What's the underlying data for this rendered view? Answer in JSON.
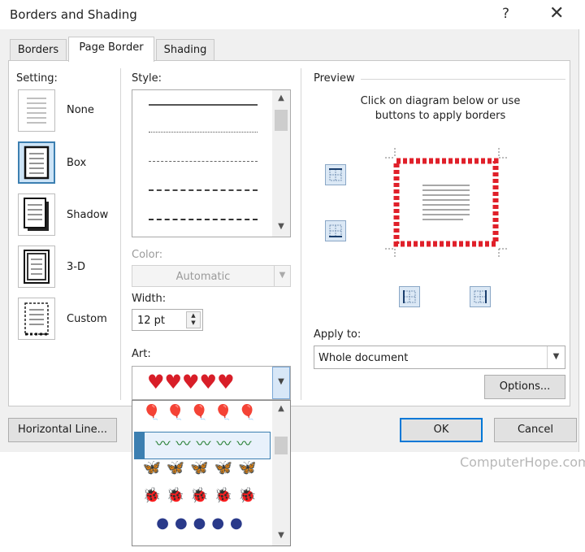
{
  "window": {
    "title": "Borders and Shading",
    "help": "?",
    "close": "✕"
  },
  "tabs": [
    {
      "label": "Borders",
      "active": false
    },
    {
      "label": "Page Border",
      "active": true
    },
    {
      "label": "Shading",
      "active": false
    }
  ],
  "setting": {
    "label": "Setting:",
    "options": [
      {
        "label": "None",
        "icon": "setting-none-icon",
        "selected": false
      },
      {
        "label": "Box",
        "icon": "setting-box-icon",
        "selected": true
      },
      {
        "label": "Shadow",
        "icon": "setting-shadow-icon",
        "selected": false
      },
      {
        "label": "3-D",
        "icon": "setting-3d-icon",
        "selected": false
      },
      {
        "label": "Custom",
        "icon": "setting-custom-icon",
        "selected": false
      }
    ]
  },
  "style": {
    "label": "Style:",
    "lines": [
      "solid",
      "dotted",
      "dashed-fine",
      "dashed",
      "dash-dot"
    ]
  },
  "color": {
    "label": "Color:",
    "value": "Automatic",
    "enabled": false
  },
  "width": {
    "label": "Width:",
    "value": "12 pt"
  },
  "art": {
    "label": "Art:",
    "selected": "red hearts",
    "options": [
      "red balloons",
      "green vines",
      "purple butterflies",
      "red ladybugs",
      "dark globes"
    ],
    "highlighted_index": 1,
    "highlight_color": "#3c7fb1"
  },
  "preview": {
    "label": "Preview",
    "instruction_line1": "Click on diagram below or use",
    "instruction_line2": "buttons to apply borders",
    "border_color": "#e0202a"
  },
  "apply_to": {
    "label": "Apply to:",
    "value": "Whole document"
  },
  "buttons": {
    "options": "Options...",
    "horizontal_line": "Horizontal Line...",
    "ok": "OK",
    "cancel": "Cancel"
  },
  "watermark": "ComputerHope.com",
  "colors": {
    "accent": "#0078d7",
    "dialog_bg": "#f0f0f0",
    "selected_bg": "#cde4f7"
  }
}
